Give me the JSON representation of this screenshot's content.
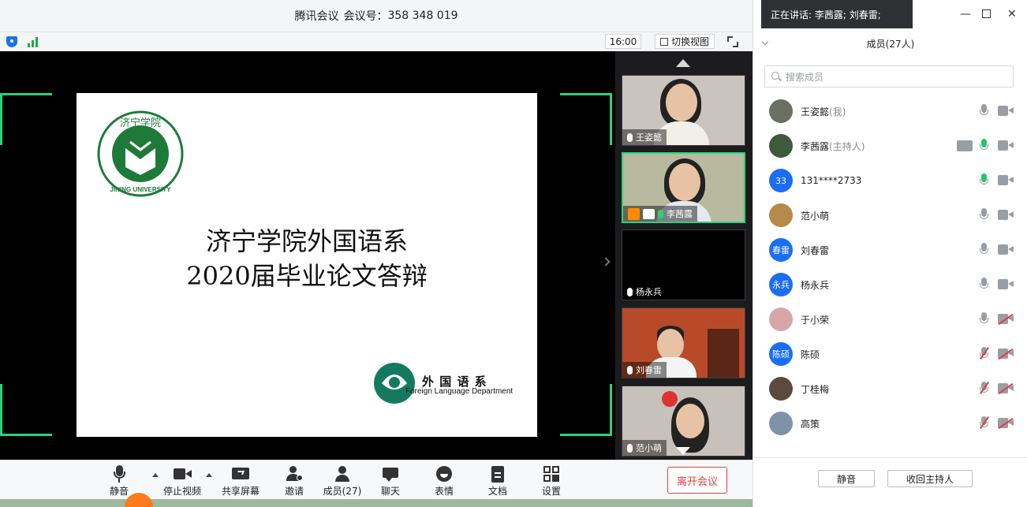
{
  "title_bar": {
    "app_name": "腾讯会议",
    "meeting_label": "会议号：",
    "meeting_id": "358 348 019"
  },
  "top_tools": {
    "time": "16:00",
    "switch_view": "切换视图"
  },
  "slide": {
    "title_line1": "济宁学院外国语系",
    "title_line2": "2020届毕业论文答辩",
    "logo_text": "济宁学院",
    "logo_english": "JINING UNIVERSITY",
    "dept_cn": "外 国 语 系",
    "dept_en": "Foreign Language Department"
  },
  "gallery": [
    {
      "name": "王姿懿",
      "mic": "on"
    },
    {
      "name": "李茜露",
      "mic": "speaking",
      "badges": [
        "host",
        "sharing"
      ]
    },
    {
      "name": "杨永兵",
      "mic": "on"
    },
    {
      "name": "刘春雷",
      "mic": "on"
    },
    {
      "name": "范小萌",
      "mic": "on"
    }
  ],
  "toolbar": {
    "mute": "静音",
    "stop_video": "停止视频",
    "share_screen": "共享屏幕",
    "invite": "邀请",
    "members": "成员(27)",
    "chat": "聊天",
    "emoji": "表情",
    "docs": "文档",
    "settings": "设置",
    "leave": "离开会议"
  },
  "panel": {
    "speaking_toast": "正在讲话: 李茜露; 刘春雷;",
    "header": "成员(27人)",
    "search_placeholder": "搜索成员",
    "members": [
      {
        "name": "王姿懿",
        "role": "(我)",
        "avatar_text": "",
        "avatar_color": "#6b6f63",
        "mic": "on",
        "cam": "on"
      },
      {
        "name": "李茜露",
        "role": "(主持人)",
        "avatar_text": "",
        "avatar_color": "#3d5a3a",
        "mic": "speaking",
        "cam": "on",
        "sharing": true
      },
      {
        "name": "131****2733",
        "role": "",
        "avatar_text": "33",
        "avatar_color": "#1a6ef5",
        "mic": "speaking",
        "cam": "on"
      },
      {
        "name": "范小萌",
        "role": "",
        "avatar_text": "",
        "avatar_color": "#b58a4a",
        "mic": "on",
        "cam": "on"
      },
      {
        "name": "刘春雷",
        "role": "",
        "avatar_text": "春雷",
        "avatar_color": "#1a6ef5",
        "mic": "on",
        "cam": "on"
      },
      {
        "name": "杨永兵",
        "role": "",
        "avatar_text": "永兵",
        "avatar_color": "#1a6ef5",
        "mic": "on",
        "cam": "on"
      },
      {
        "name": "于小荣",
        "role": "",
        "avatar_text": "",
        "avatar_color": "#d9a6a8",
        "mic": "on",
        "cam": "off"
      },
      {
        "name": "陈硕",
        "role": "",
        "avatar_text": "陈硕",
        "avatar_color": "#1a6ef5",
        "mic": "muted",
        "cam": "off"
      },
      {
        "name": "丁桂梅",
        "role": "",
        "avatar_text": "",
        "avatar_color": "#5b4a3e",
        "mic": "muted",
        "cam": "off"
      },
      {
        "name": "高策",
        "role": "",
        "avatar_text": "",
        "avatar_color": "#7f93a8",
        "mic": "muted",
        "cam": "off"
      }
    ],
    "footer_mute": "静音",
    "footer_reclaim_host": "收回主持人"
  },
  "colors": {
    "accent_green": "#2bd17c",
    "leave_red": "#e04040",
    "avatar_blue": "#1a6ef5"
  }
}
